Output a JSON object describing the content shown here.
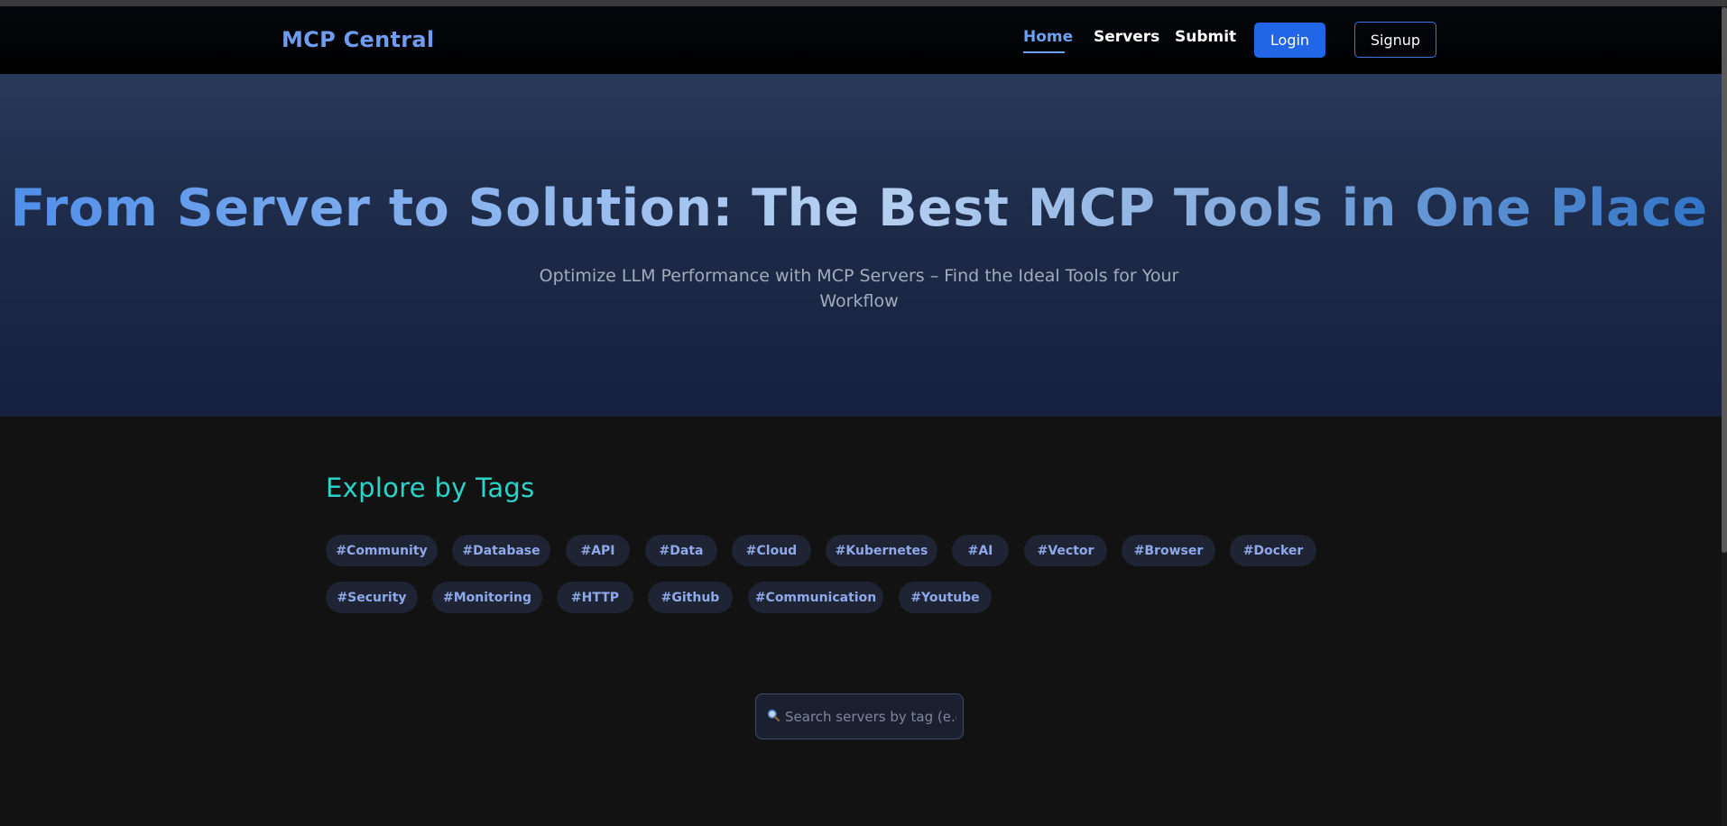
{
  "nav": {
    "brand": "MCP Central",
    "links": [
      "Home",
      "Servers",
      "Submit"
    ],
    "active": "Home",
    "login": "Login",
    "signup": "Signup"
  },
  "hero": {
    "title": "From Server to Solution: The Best MCP Tools in One Place",
    "subtitle_line1": "Optimize LLM Performance with MCP Servers – Find the Ideal Tools for Your",
    "subtitle_line2": "Workflow"
  },
  "tags_section": {
    "title": "Explore by Tags",
    "row1": [
      "#Community",
      "#Database",
      "#API",
      "#Data",
      "#Cloud",
      "#Kubernetes",
      "#AI",
      "#Vector",
      "#Browser",
      "#Docker"
    ],
    "row2": [
      "#Security",
      "#Monitoring",
      "#HTTP",
      "#Github",
      "#Communication",
      "#Youtube"
    ]
  },
  "search": {
    "icon": "magnifier-icon",
    "placeholder": "Search servers by tag (e.g"
  },
  "colors": {
    "brand": "#6e9cf0",
    "accent": "#2166e6",
    "section_title": "#2ad4c8",
    "tag_bg": "#1e2433",
    "tag_text": "#8fa8ea"
  }
}
